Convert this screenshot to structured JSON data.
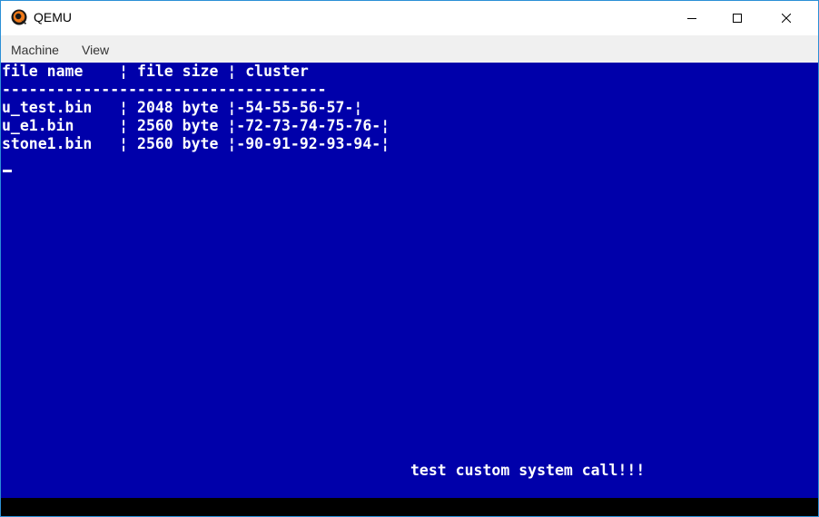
{
  "window": {
    "title": "QEMU",
    "icon": "qemu-logo-icon",
    "controls": [
      "minimize-icon",
      "maximize-icon",
      "close-icon"
    ]
  },
  "menu": {
    "items": [
      "Machine",
      "View"
    ]
  },
  "console": {
    "header": "file name    ¦ file size ¦ cluster",
    "separator": "------------------------------------",
    "rows": [
      "u_test.bin   ¦ 2048 byte ¦-54-55-56-57-¦",
      "u_e1.bin     ¦ 2560 byte ¦-72-73-74-75-76-¦",
      "stone1.bin   ¦ 2560 byte ¦-90-91-92-93-94-¦"
    ],
    "message": "test custom system call!!!"
  },
  "colors": {
    "screen_background": "#0000aa",
    "screen_text": "#ffffff",
    "window_border": "#2b8fd6",
    "menubar": "#f0f0f0"
  }
}
